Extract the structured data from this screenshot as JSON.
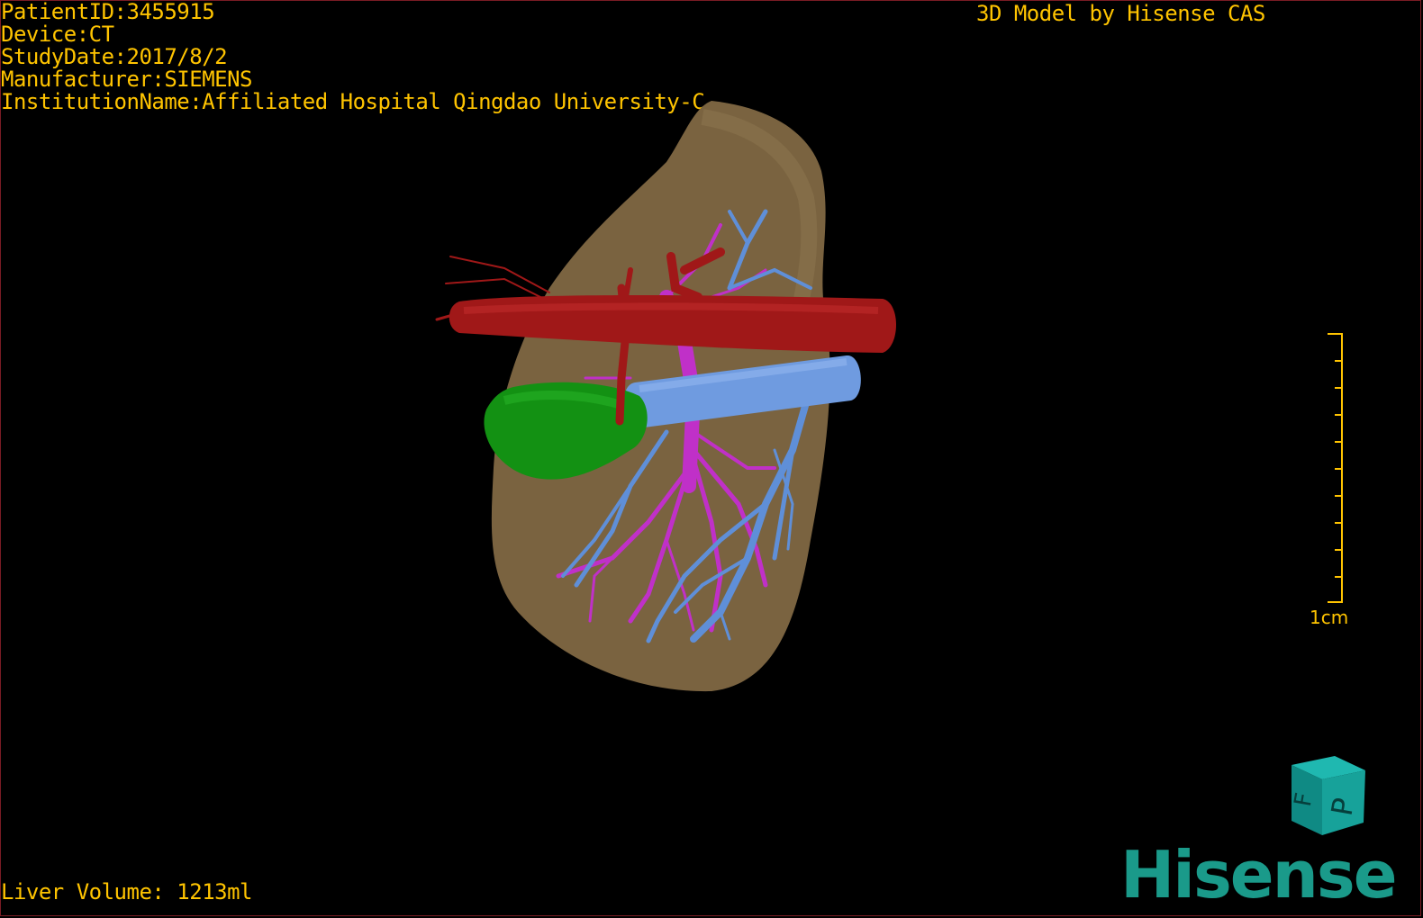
{
  "header": {
    "patient_id": "PatientID:3455915",
    "device": "Device:CT",
    "study_date": "StudyDate:2017/8/2",
    "manufacturer": "Manufacturer:SIEMENS",
    "institution": "InstitutionName:Affiliated Hospital Qingdao University-C"
  },
  "title": "3D Model by Hisense CAS",
  "scale_bar": {
    "label": "1cm"
  },
  "footer": {
    "liver_volume": "Liver Volume: 1213ml"
  },
  "orientation_cube": {
    "face_front": "P",
    "face_side": "F"
  },
  "brand": {
    "logo": "Hisense",
    "color": "#1a9a8a"
  },
  "colors": {
    "text": "#ffc400",
    "liver": "#7a6340",
    "artery": "#a01818",
    "portal_vein": "#5f8fd8",
    "hepatic_vein": "#c030c8",
    "gallbladder": "#139113"
  }
}
